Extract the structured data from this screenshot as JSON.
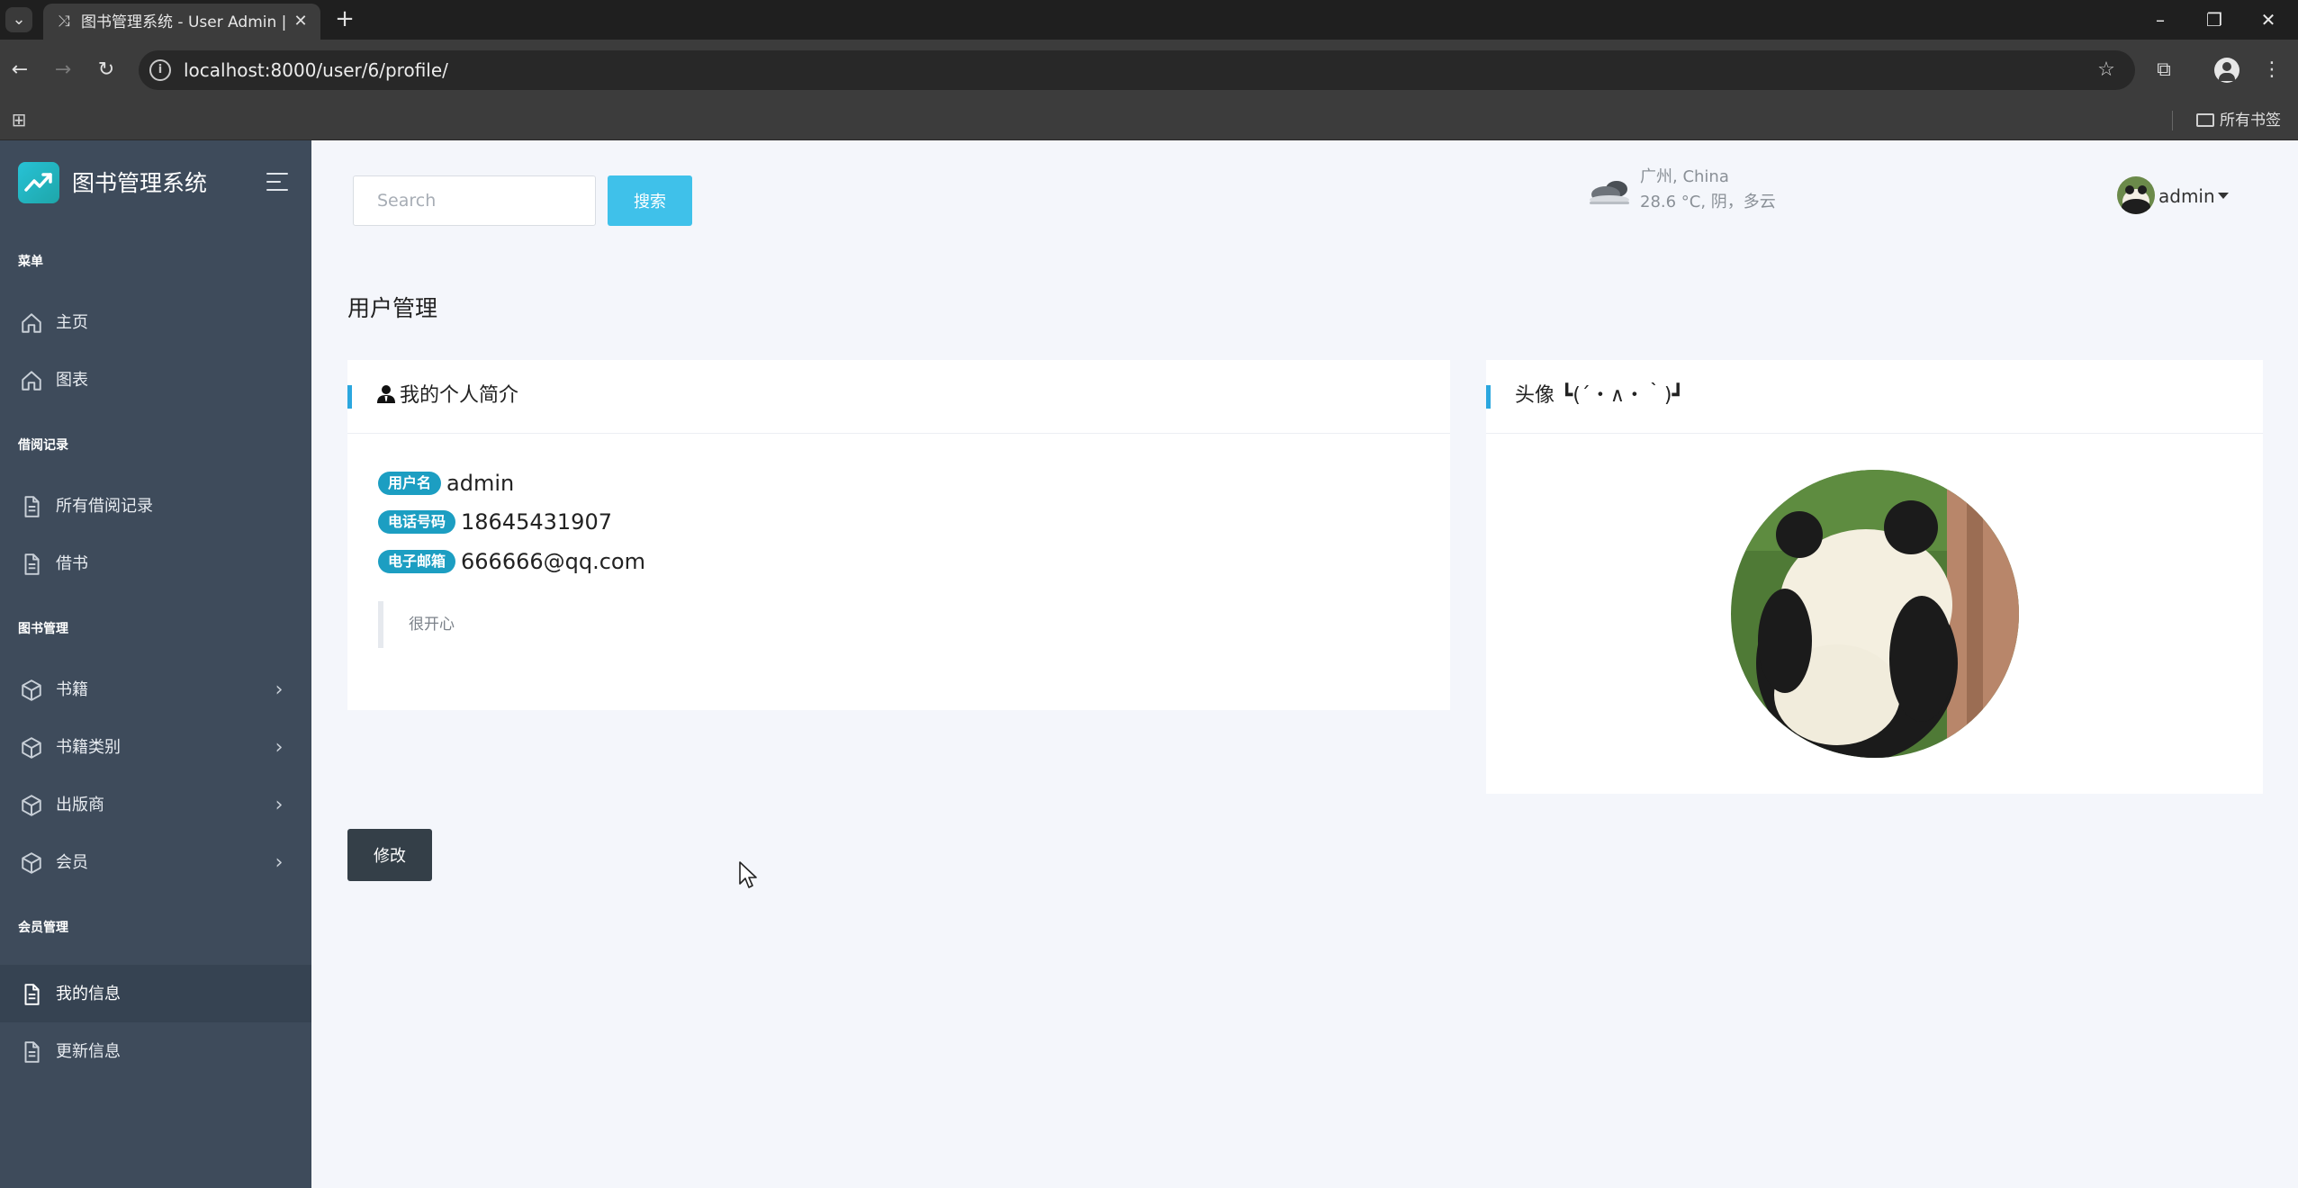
{
  "browser": {
    "tab_title": "图书管理系统 - User Admin | A",
    "url": "localhost:8000/user/6/profile/",
    "bookmarks_folder": "所有书签"
  },
  "sidebar": {
    "brand": "图书管理系统",
    "sections": [
      {
        "heading": "菜单",
        "items": [
          {
            "label": "主页",
            "icon": "home-icon"
          },
          {
            "label": "图表",
            "icon": "home-icon"
          }
        ]
      },
      {
        "heading": "借阅记录",
        "items": [
          {
            "label": "所有借阅记录",
            "icon": "document-icon"
          },
          {
            "label": "借书",
            "icon": "document-icon"
          }
        ]
      },
      {
        "heading": "图书管理",
        "items": [
          {
            "label": "书籍",
            "icon": "cube-icon"
          },
          {
            "label": "书籍类别",
            "icon": "cube-icon"
          },
          {
            "label": "出版商",
            "icon": "cube-icon"
          },
          {
            "label": "会员",
            "icon": "cube-icon"
          }
        ]
      },
      {
        "heading": "会员管理",
        "items": [
          {
            "label": "我的信息",
            "icon": "document-icon",
            "active": true
          },
          {
            "label": "更新信息",
            "icon": "document-icon"
          }
        ]
      }
    ]
  },
  "search": {
    "placeholder": "Search",
    "button_label": "搜索"
  },
  "weather": {
    "city": "广州, China",
    "description": "28.6 °C, 阴，多云",
    "icon": "cloudy-weather-icon"
  },
  "user_menu": {
    "name": "admin"
  },
  "page_title": "用户管理",
  "profile_card": {
    "title": "我的个人简介",
    "fields": [
      {
        "label": "用户名",
        "value": "admin"
      },
      {
        "label": "电话号码",
        "value": "18645431907"
      },
      {
        "label": "电子邮箱",
        "value": "666666@qq.com"
      }
    ],
    "bio": "很开心"
  },
  "avatar_card": {
    "title": "头像 ┗(´・∧・｀)┛"
  },
  "edit_button_label": "修改",
  "colors": {
    "sidebar_bg": "#3e4b5b",
    "accent": "#3fc1ea",
    "badge": "#1c9ec2",
    "card_accent": "#2ba7df",
    "edit_button": "#343f48"
  }
}
